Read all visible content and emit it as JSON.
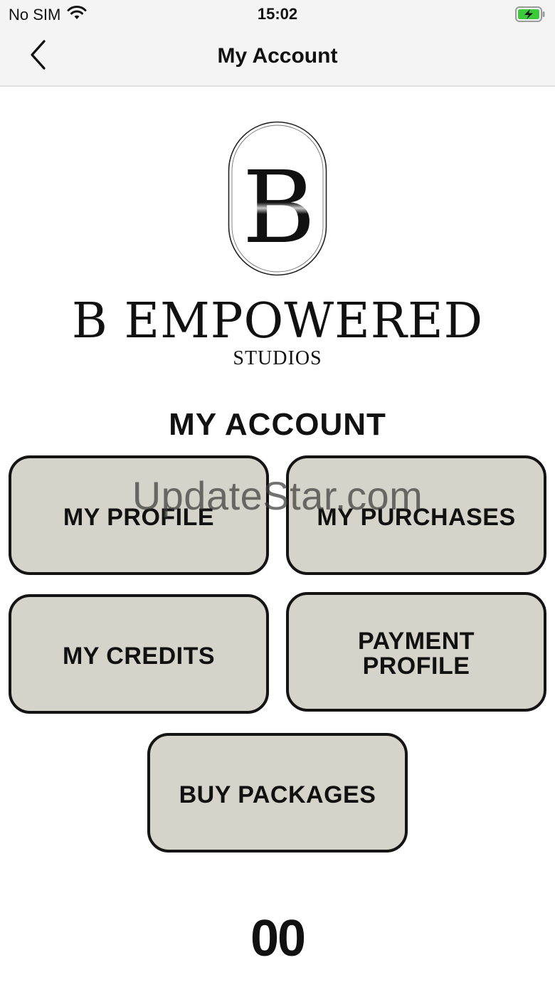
{
  "status_bar": {
    "carrier": "No SIM",
    "time": "15:02",
    "icons": [
      "wifi-icon",
      "battery-charging-icon"
    ],
    "battery_color": "#3cc93c"
  },
  "nav": {
    "title": "My Account",
    "back_icon": "chevron-left-icon"
  },
  "brand": {
    "name": "B EMPOWERED",
    "subtitle": "STUDIOS",
    "logo_letter": "B"
  },
  "section": {
    "title": "MY ACCOUNT"
  },
  "buttons": [
    {
      "label": "MY PROFILE"
    },
    {
      "label": "MY PURCHASES"
    },
    {
      "label": "MY CREDITS"
    },
    {
      "label_line1": "PAYMENT",
      "label_line2": "PROFILE"
    },
    {
      "label": "BUY PACKAGES"
    }
  ],
  "watermark": "UpdateStar.com",
  "counter": "00",
  "colors": {
    "tile_background": "#d6d3ca",
    "tile_border": "#141414",
    "bar_background": "#f4f4f4"
  }
}
